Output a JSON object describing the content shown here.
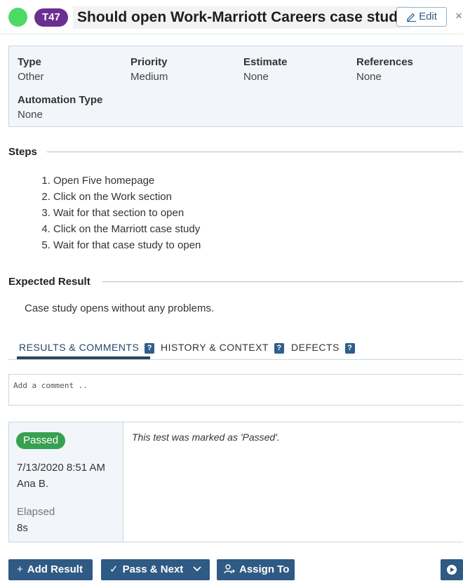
{
  "header": {
    "test_id": "T47",
    "title": "Should open Work-Marriott Careers case study",
    "edit_label": "Edit",
    "close_glyph": "×",
    "status_color": "#4cd964"
  },
  "properties": {
    "type_label": "Type",
    "type_value": "Other",
    "priority_label": "Priority",
    "priority_value": "Medium",
    "estimate_label": "Estimate",
    "estimate_value": "None",
    "references_label": "References",
    "references_value": "None",
    "automation_label": "Automation Type",
    "automation_value": "None"
  },
  "steps": {
    "heading": "Steps",
    "items": [
      "Open Five homepage",
      "Click on the Work section",
      "Wait for that section to open",
      "Click on the Marriott case study",
      "Wait for that case study to open"
    ]
  },
  "expected": {
    "heading": "Expected Result",
    "text": "Case study opens without any problems."
  },
  "tabs": {
    "results": "RESULTS & COMMENTS",
    "history": "HISTORY & CONTEXT",
    "defects": "DEFECTS",
    "help_glyph": "?"
  },
  "comment": {
    "placeholder": "Add a comment .."
  },
  "result": {
    "status": "Passed",
    "date": "7/13/2020 8:51 AM",
    "user": "Ana B.",
    "elapsed_label": "Elapsed",
    "elapsed_value": "8s",
    "message": "This test was marked as 'Passed'."
  },
  "actions": {
    "add_result": "Add Result",
    "pass_next": "Pass & Next",
    "assign_to": "Assign To"
  },
  "colors": {
    "accent": "#2f5a83",
    "badge": "#6b2f8f",
    "passed": "#36a150"
  }
}
